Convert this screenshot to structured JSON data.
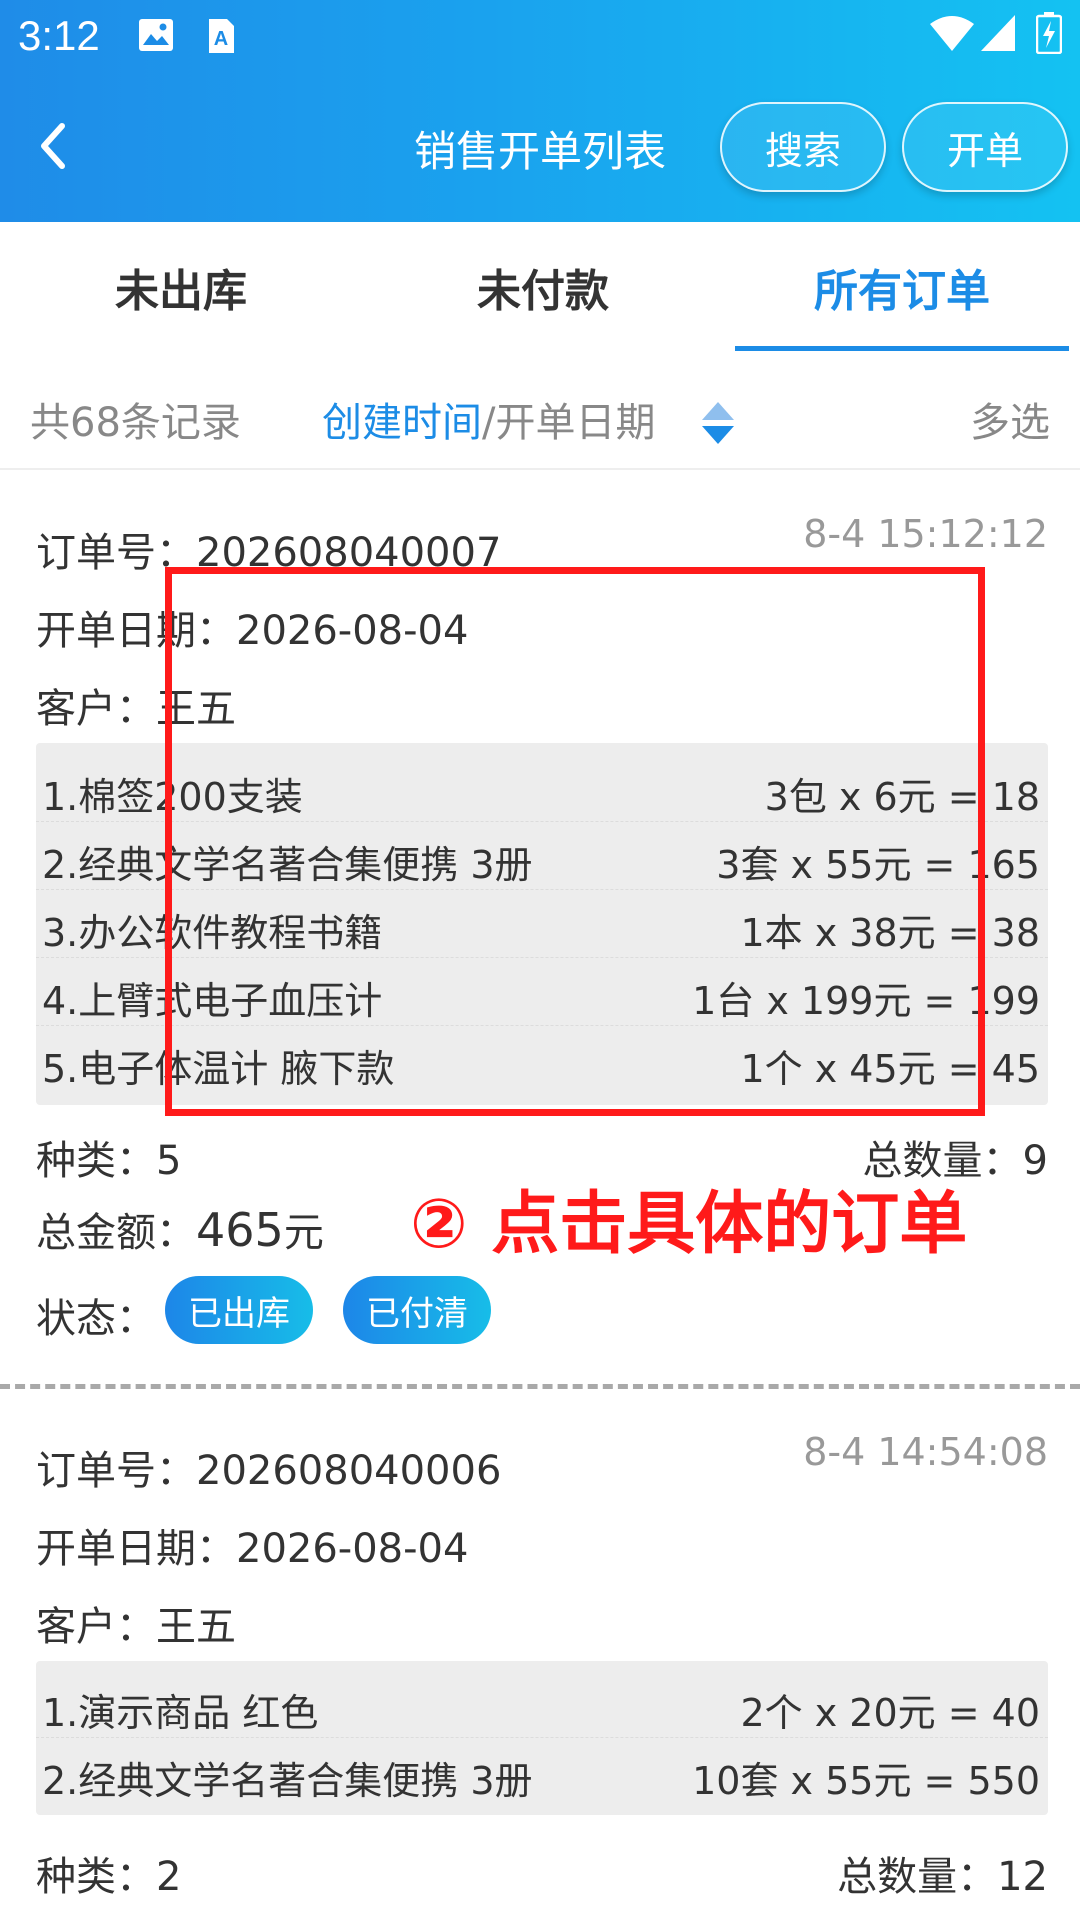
{
  "status_bar": {
    "time": "3:12",
    "icons": [
      "image-icon",
      "a-icon",
      "wifi-icon",
      "signal-icon",
      "battery-icon"
    ]
  },
  "nav": {
    "title": "销售开单列表",
    "search_label": "搜索",
    "create_label": "开单",
    "back_icon": "chevron-left-icon"
  },
  "tabs": [
    {
      "label": "未出库",
      "active": false
    },
    {
      "label": "未付款",
      "active": false
    },
    {
      "label": "所有订单",
      "active": true
    }
  ],
  "filter": {
    "count": "共68条记录",
    "sort_active": "创建时间",
    "sort_separator": "/",
    "sort_other": "开单日期",
    "multi": "多选"
  },
  "orders": [
    {
      "order_no": "订单号：202608040007",
      "time": "8-4 15:12:12",
      "date": "开单日期：2026-08-04",
      "customer": "客户：王五",
      "items": [
        {
          "name": "1.棉签200支装",
          "calc": "3包 x 6元 = 18"
        },
        {
          "name": "2.经典文学名著合集便携 3册",
          "calc": "3套 x 55元 = 165"
        },
        {
          "name": "3.办公软件教程书籍",
          "calc": "1本 x 38元 = 38"
        },
        {
          "name": "4.上臂式电子血压计",
          "calc": "1台 x 199元 = 199"
        },
        {
          "name": "5.电子体温计 腋下款",
          "calc": "1个 x 45元 = 45"
        }
      ],
      "kinds": "种类：5",
      "total_qty": "总数量：9",
      "amount_label": "总金额：",
      "amount_value": "465",
      "amount_unit": "元",
      "status_label": "状态：",
      "badges": [
        "已出库",
        "已付清"
      ]
    },
    {
      "order_no": "订单号：202608040006",
      "time": "8-4 14:54:08",
      "date": "开单日期：2026-08-04",
      "customer": "客户：王五",
      "items": [
        {
          "name": "1.演示商品 红色",
          "calc": "2个 x 20元 = 40"
        },
        {
          "name": "2.经典文学名著合集便携 3册",
          "calc": "10套 x 55元 = 550"
        }
      ],
      "kinds": "种类：2",
      "total_qty": "总数量：12"
    }
  ],
  "annotation": {
    "text": "② 点击具体的订单",
    "color": "#ff1a1a"
  },
  "colors": {
    "accent": "#1c8ce6",
    "header_start": "#1f8ce8",
    "header_end": "#14c2f2"
  }
}
